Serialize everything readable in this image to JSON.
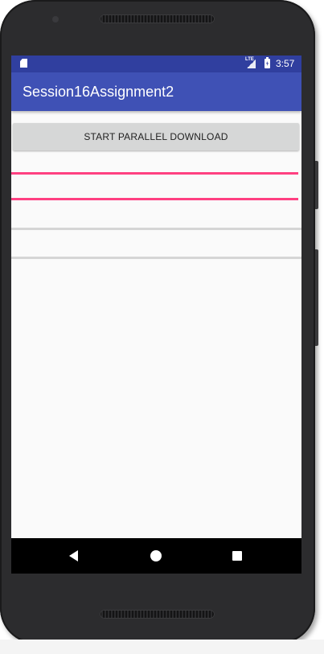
{
  "device": {
    "frame_color": "#2c2c2e"
  },
  "status_bar": {
    "background": "#303f9f",
    "network_label": "LTE",
    "time": "3:57",
    "icons": [
      "sd-card-icon",
      "signal-icon",
      "battery-charging-icon"
    ]
  },
  "app_bar": {
    "title": "Session16Assignment2",
    "background": "#3f51b5"
  },
  "main": {
    "start_button_label": "START PARALLEL DOWNLOAD",
    "progress_bars": [
      {
        "progress": 1.0,
        "color": "#ff4081"
      },
      {
        "progress": 1.0,
        "color": "#ff4081"
      },
      {
        "progress": 0.0,
        "color": "#d5d5d5"
      },
      {
        "progress": 0.0,
        "color": "#d5d5d5"
      }
    ]
  },
  "nav_bar": {
    "buttons": [
      "back-icon",
      "home-icon",
      "recents-icon"
    ]
  }
}
